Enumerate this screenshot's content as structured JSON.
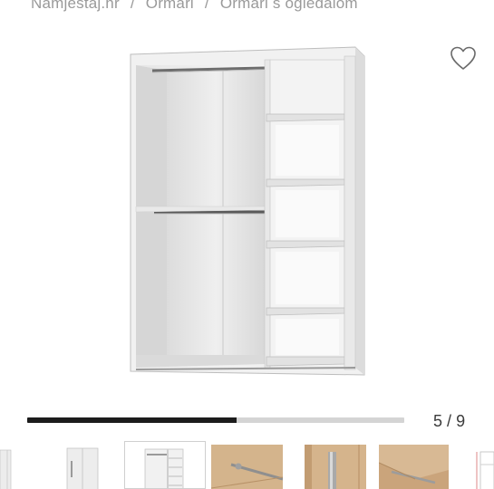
{
  "breadcrumb": {
    "items": [
      {
        "label": "Namjestaj.hr"
      },
      {
        "label": "Ormari"
      },
      {
        "label": "Ormari s ogledalom"
      }
    ],
    "separator": "/"
  },
  "gallery": {
    "favorite_icon": "heart-outline-icon",
    "current": "5",
    "total": "9",
    "divider": "/",
    "progress_fraction": 0.556,
    "thumbnails": [
      {
        "name": "thumb-wardrobe-edge",
        "active": false
      },
      {
        "name": "thumb-wardrobe-closed",
        "active": false
      },
      {
        "name": "thumb-wardrobe-interior",
        "active": true
      },
      {
        "name": "thumb-oak-rail-detail",
        "active": false
      },
      {
        "name": "thumb-oak-handle-detail",
        "active": false
      },
      {
        "name": "thumb-oak-corner-detail",
        "active": false
      },
      {
        "name": "thumb-dimensions",
        "active": false
      }
    ]
  },
  "colors": {
    "progress_track": "#d4d4d4",
    "progress_fill": "#1c1c1c",
    "wood": "#c9a57c",
    "cabinet": "#f4f4f4"
  }
}
